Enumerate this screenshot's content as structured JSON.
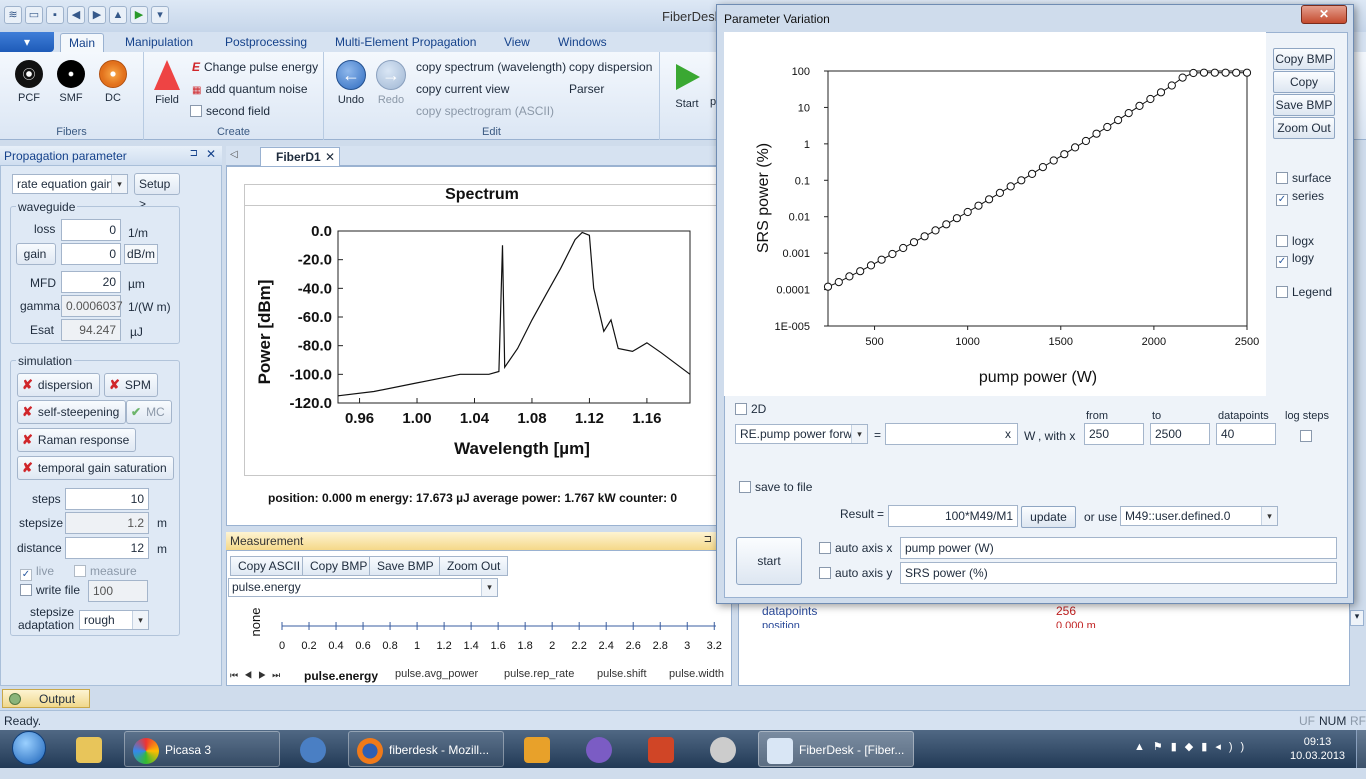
{
  "app": {
    "title": "FiberDesk"
  },
  "ribbon": {
    "app_menu": "▾",
    "tabs": [
      "Main",
      "Manipulation",
      "Postprocessing",
      "Multi-Element Propagation",
      "View",
      "Windows"
    ],
    "fibers": {
      "pcf": "PCF",
      "smf": "SMF",
      "dc": "DC",
      "label": "Fibers"
    },
    "create": {
      "field": "Field",
      "change_pulse_energy": "Change pulse energy",
      "add_quantum_noise": "add quantum noise",
      "second_field": "second field",
      "label": "Create"
    },
    "edit": {
      "undo": "Undo",
      "redo": "Redo",
      "copy_spectrum": "copy spectrum (wavelength)",
      "copy_current_view": "copy current view",
      "copy_spectrogram": "copy spectrogram (ASCII)",
      "copy_dispersion": "copy dispersion",
      "parser": "Parser",
      "label": "Edit"
    },
    "start": "Start",
    "extra": "p"
  },
  "prop_panel": {
    "title": "Propagation parameter",
    "mode": "rate equation gain",
    "setup": "Setup >",
    "waveguide_label": "waveguide",
    "loss": {
      "label": "loss",
      "value": "0",
      "unit": "1/m"
    },
    "gain": {
      "label": "gain",
      "value": "0",
      "unit": "dB/m"
    },
    "mfd": {
      "label": "MFD",
      "value": "20",
      "unit": "µm"
    },
    "gamma": {
      "label": "gamma",
      "value": "0.0006037",
      "unit": "1/(W m)"
    },
    "esat": {
      "label": "Esat",
      "value": "94.247",
      "unit": "µJ"
    },
    "simulation_label": "simulation",
    "dispersion": "dispersion",
    "spm": "SPM",
    "self_steepening": "self-steepening",
    "mc": "MC",
    "raman": "Raman response",
    "temporal_gain": "temporal gain saturation",
    "steps": {
      "label": "steps",
      "value": "10"
    },
    "stepsize": {
      "label": "stepsize",
      "value": "1.2",
      "unit": "m"
    },
    "distance": {
      "label": "distance",
      "value": "12",
      "unit": "m"
    },
    "live": "live",
    "measure": "measure",
    "write_file": {
      "label": "write file",
      "value": "100"
    },
    "stepsize_adaptation": {
      "label1": "stepsize",
      "label2": "adaptation",
      "value": "rough"
    }
  },
  "doc": {
    "tab": "FiberD1",
    "spectrum_title": "Spectrum",
    "status": "position: 0.000 m   energy: 17.673 µJ   average power: 1.767 kW   counter: 0"
  },
  "spectrum_chart": {
    "xlabel": "Wavelength [µm]",
    "ylabel": "Power [dBm]",
    "xticks": [
      "0.96",
      "1.00",
      "1.04",
      "1.08",
      "1.12",
      "1.16"
    ],
    "yticks": [
      "0.0",
      "-20.0",
      "-40.0",
      "-60.0",
      "-80.0",
      "-100.0",
      "-120.0"
    ],
    "xlim": [
      0.945,
      1.19
    ],
    "ylim": [
      -120,
      0
    ],
    "line": [
      [
        0.945,
        -115
      ],
      [
        0.97,
        -112
      ],
      [
        1.0,
        -106
      ],
      [
        1.03,
        -100
      ],
      [
        1.05,
        -100
      ],
      [
        1.057,
        -98
      ],
      [
        1.0595,
        -10
      ],
      [
        1.061,
        -95
      ],
      [
        1.07,
        -82
      ],
      [
        1.08,
        -62
      ],
      [
        1.09,
        -44
      ],
      [
        1.1,
        -26
      ],
      [
        1.11,
        -6
      ],
      [
        1.115,
        -1
      ],
      [
        1.12,
        -3
      ],
      [
        1.123,
        -40
      ],
      [
        1.13,
        -70
      ],
      [
        1.135,
        -62
      ],
      [
        1.14,
        -82
      ],
      [
        1.15,
        -84
      ],
      [
        1.16,
        -78
      ],
      [
        1.17,
        -85
      ],
      [
        1.19,
        -100
      ]
    ]
  },
  "measurement": {
    "title": "Measurement",
    "copy_ascii": "Copy ASCII",
    "copy_bmp": "Copy BMP",
    "save_bmp": "Save BMP",
    "zoom_out": "Zoom Out",
    "selector": "pulse.energy",
    "ylabel": "none",
    "xticks": [
      "0",
      "0.2",
      "0.4",
      "0.6",
      "0.8",
      "1",
      "1.2",
      "1.4",
      "1.6",
      "1.8",
      "2",
      "2.2",
      "2.4",
      "2.6",
      "2.8",
      "3",
      "3.2"
    ],
    "tabs": [
      "pulse.energy",
      "pulse.avg_power",
      "pulse.rep_rate",
      "pulse.shift",
      "pulse.width"
    ]
  },
  "background_table": {
    "row1": {
      "label": "datapoints",
      "value": "256"
    },
    "row2": {
      "label": "position",
      "value": "0.000 m"
    }
  },
  "dialog": {
    "title": "Parameter Variation",
    "close": "✕",
    "copy_bmp": "Copy BMP",
    "copy_ascii": "Copy ASCII",
    "save_bmp": "Save BMP",
    "zoom_out": "Zoom Out",
    "surface": "surface",
    "series": "series",
    "logx": "logx",
    "logy": "logy",
    "legend": "Legend",
    "two_d": "2D",
    "param_select": "RE.pump power forwar",
    "equals": "=",
    "clear_x": "x",
    "unit": "W",
    "with_x": ", with x",
    "from_label": "from",
    "from_value": "250",
    "to_label": "to",
    "to_value": "2500",
    "datapoints_label": "datapoints",
    "datapoints_value": "40",
    "log_steps": "log steps",
    "save_to_file": "save to file",
    "result_label": "Result",
    "result_eq": "=",
    "result_value": "100*M49/M1",
    "update": "update",
    "or_use": "or use",
    "use_select": "M49::user.defined.0",
    "start": "start",
    "auto_axis_x": "auto axis x",
    "auto_axis_y": "auto axis y",
    "axis_x_label": "pump power (W)",
    "axis_y_label": "SRS power (%)"
  },
  "chart_data": {
    "type": "scatter",
    "xlabel": "pump power (W)",
    "ylabel": "SRS power (%)",
    "xlim": [
      250,
      2500
    ],
    "ylim": [
      1e-05,
      100
    ],
    "log_y": true,
    "xticks": [
      "500",
      "1000",
      "1500",
      "2000",
      "2500"
    ],
    "yticks": [
      "100",
      "10",
      "1",
      "0.1",
      "0.01",
      "0.001",
      "0.0001",
      "1E-005"
    ],
    "x": [
      250,
      308,
      365,
      423,
      481,
      538,
      596,
      654,
      712,
      769,
      827,
      885,
      942,
      1000,
      1058,
      1115,
      1173,
      1231,
      1288,
      1346,
      1404,
      1462,
      1519,
      1577,
      1635,
      1692,
      1750,
      1808,
      1865,
      1923,
      1981,
      2038,
      2096,
      2154,
      2212,
      2269,
      2327,
      2385,
      2442,
      2500
    ],
    "y": [
      0.00012,
      0.00016,
      0.00023,
      0.00032,
      0.00046,
      0.00066,
      0.00095,
      0.00138,
      0.002,
      0.0029,
      0.0042,
      0.0062,
      0.0091,
      0.0135,
      0.02,
      0.03,
      0.045,
      0.068,
      0.1,
      0.15,
      0.23,
      0.35,
      0.52,
      0.8,
      1.2,
      1.9,
      2.9,
      4.5,
      7.0,
      11,
      17,
      26,
      40,
      66,
      88,
      90,
      90,
      90,
      90,
      90
    ]
  },
  "output": {
    "tab": "Output"
  },
  "status": {
    "text": "Ready.",
    "uf": "UF",
    "num": "NUM",
    "rf": "RF"
  },
  "taskbar": {
    "picasa": "Picasa 3",
    "firefox": "fiberdesk - Mozill...",
    "fiberdesk": "FiberDesk - [Fiber...",
    "time": "09:13",
    "date": "10.03.2013"
  }
}
